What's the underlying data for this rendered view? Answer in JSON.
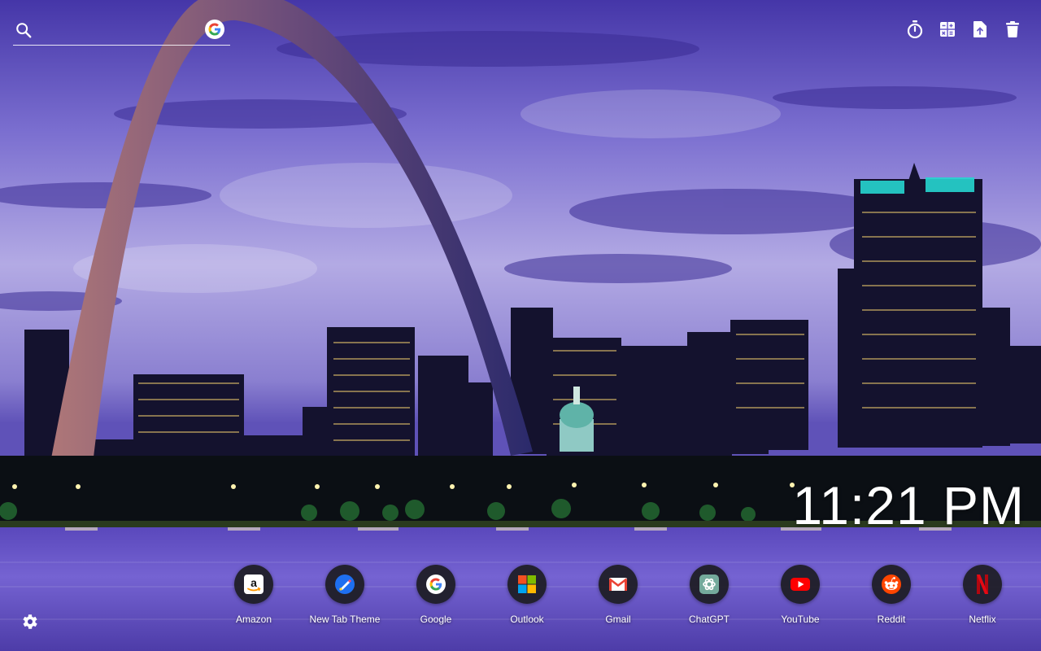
{
  "search": {
    "placeholder": "",
    "value": "",
    "engine_icon": "google-g-icon",
    "search_icon": "search-icon"
  },
  "toolbar": {
    "items": [
      {
        "icon": "timer-icon"
      },
      {
        "icon": "calculator-icon"
      },
      {
        "icon": "file-upload-icon"
      },
      {
        "icon": "trash-icon"
      }
    ]
  },
  "clock": {
    "time": "11:21 PM"
  },
  "shortcuts": [
    {
      "label": "Amazon",
      "icon": "amazon-icon"
    },
    {
      "label": "New Tab Theme",
      "icon": "new-tab-theme-icon"
    },
    {
      "label": "Google",
      "icon": "google-icon"
    },
    {
      "label": "Outlook",
      "icon": "outlook-icon"
    },
    {
      "label": "Gmail",
      "icon": "gmail-icon"
    },
    {
      "label": "ChatGPT",
      "icon": "chatgpt-icon"
    },
    {
      "label": "YouTube",
      "icon": "youtube-icon"
    },
    {
      "label": "Reddit",
      "icon": "reddit-icon"
    },
    {
      "label": "Netflix",
      "icon": "netflix-icon"
    }
  ],
  "settings": {
    "icon": "gear-icon"
  },
  "colors": {
    "sky_top": "#4a3bb0",
    "sky_mid": "#8f86d8",
    "horizon": "#c8c0ea",
    "water": "#6a58c8",
    "tile_bg": "#1c1c22",
    "text": "#ffffff"
  }
}
